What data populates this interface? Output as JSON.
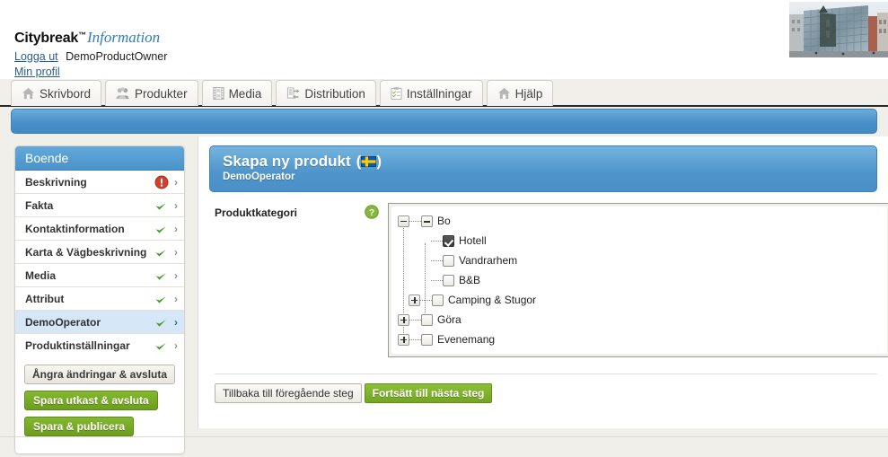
{
  "brand": {
    "name": "Citybreak",
    "tm": "™",
    "suffix": "Information"
  },
  "account": {
    "logout_label": "Logga ut",
    "username": "DemoProductOwner",
    "profile_label": "Min profil"
  },
  "tabs": [
    {
      "label": "Skrivbord",
      "icon": "home-icon"
    },
    {
      "label": "Produkter",
      "icon": "people-icon"
    },
    {
      "label": "Media",
      "icon": "film-icon"
    },
    {
      "label": "Distribution",
      "icon": "distribution-icon"
    },
    {
      "label": "Inställningar",
      "icon": "clipboard-icon"
    },
    {
      "label": "Hjälp",
      "icon": "home-icon"
    }
  ],
  "sidebar": {
    "title": "Boende",
    "items": [
      {
        "label": "Beskrivning",
        "status": "error",
        "active": false
      },
      {
        "label": "Fakta",
        "status": "ok",
        "active": false
      },
      {
        "label": "Kontaktinformation",
        "status": "ok",
        "active": false
      },
      {
        "label": "Karta & Vägbeskrivning",
        "status": "ok",
        "active": false
      },
      {
        "label": "Media",
        "status": "ok",
        "active": false
      },
      {
        "label": "Attribut",
        "status": "ok",
        "active": false
      },
      {
        "label": "DemoOperator",
        "status": "ok",
        "active": true
      },
      {
        "label": "Produktinställningar",
        "status": "ok",
        "active": false
      }
    ],
    "buttons": {
      "cancel": "Ångra ändringar & avsluta",
      "save_draft": "Spara utkast & avsluta",
      "publish": "Spara & publicera"
    }
  },
  "content": {
    "title": "Skapa ny produkt",
    "title_flag": "sweden-flag-icon",
    "subtitle": "DemoOperator",
    "field_label": "Produktkategori",
    "help_icon": "help-icon",
    "footer": {
      "back": "Tillbaka till föregående steg",
      "next": "Fortsätt till nästa steg"
    }
  },
  "category_tree": [
    {
      "label": "Bo",
      "level": 1,
      "expander": "minus",
      "checkbox": "partial"
    },
    {
      "label": "Hotell",
      "level": 2,
      "expander": "none",
      "checkbox": "checked"
    },
    {
      "label": "Vandrarhem",
      "level": 2,
      "expander": "none",
      "checkbox": "unchecked"
    },
    {
      "label": "B&B",
      "level": 2,
      "expander": "none",
      "checkbox": "unchecked"
    },
    {
      "label": "Camping & Stugor",
      "level": 2,
      "expander": "plus",
      "checkbox": "unchecked"
    },
    {
      "label": "Göra",
      "level": 1,
      "expander": "plus",
      "checkbox": "unchecked"
    },
    {
      "label": "Evenemang",
      "level": 1,
      "expander": "plus",
      "checkbox": "unchecked"
    }
  ],
  "colors": {
    "accent_blue": "#4a91c9",
    "green": "#74a524",
    "error_red": "#d2402a",
    "check_green": "#3f9b25",
    "page_bg": "#f0efe9"
  }
}
